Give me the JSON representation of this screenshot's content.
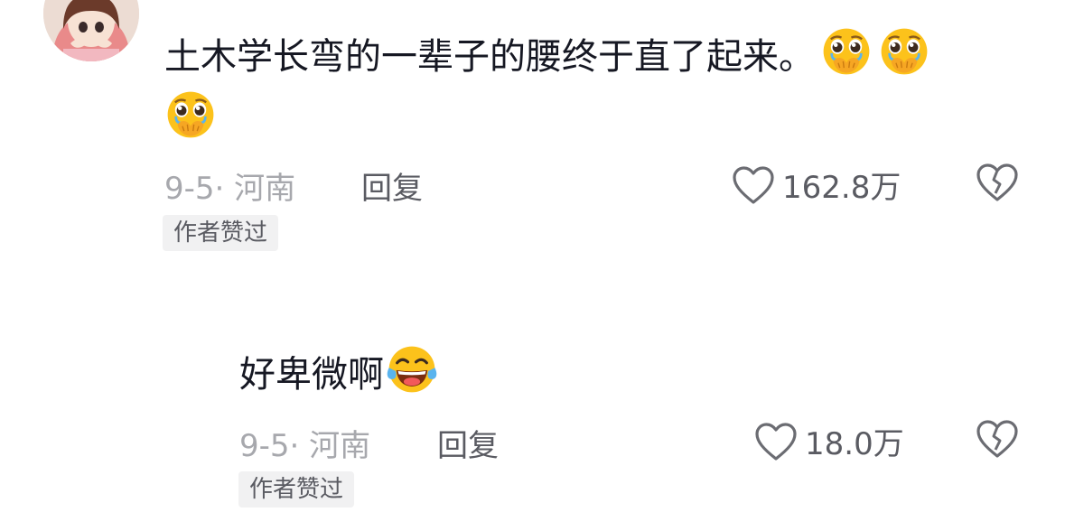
{
  "comments": [
    {
      "text": "土木学长弯的一辈子的腰终于直了起来。",
      "emojis": [
        "face-holding-back-tears-emoji",
        "face-holding-back-tears-emoji",
        "face-holding-back-tears-emoji"
      ],
      "date_location": "9-5· 河南",
      "reply_label": "回复",
      "likes": "162.8万",
      "badge": "作者赞过"
    },
    {
      "text": "好卑微啊",
      "emojis": [
        "tears-of-joy-emoji"
      ],
      "date_location": "9-5· 河南",
      "reply_label": "回复",
      "likes": "18.0万",
      "badge": "作者赞过"
    }
  ],
  "colors": {
    "primary_text": "#161823",
    "secondary_text": "#a7a8ad",
    "action_text": "#5a5b62",
    "badge_bg": "#f1f1f2",
    "emoji_yellow": "#fcc21b"
  }
}
